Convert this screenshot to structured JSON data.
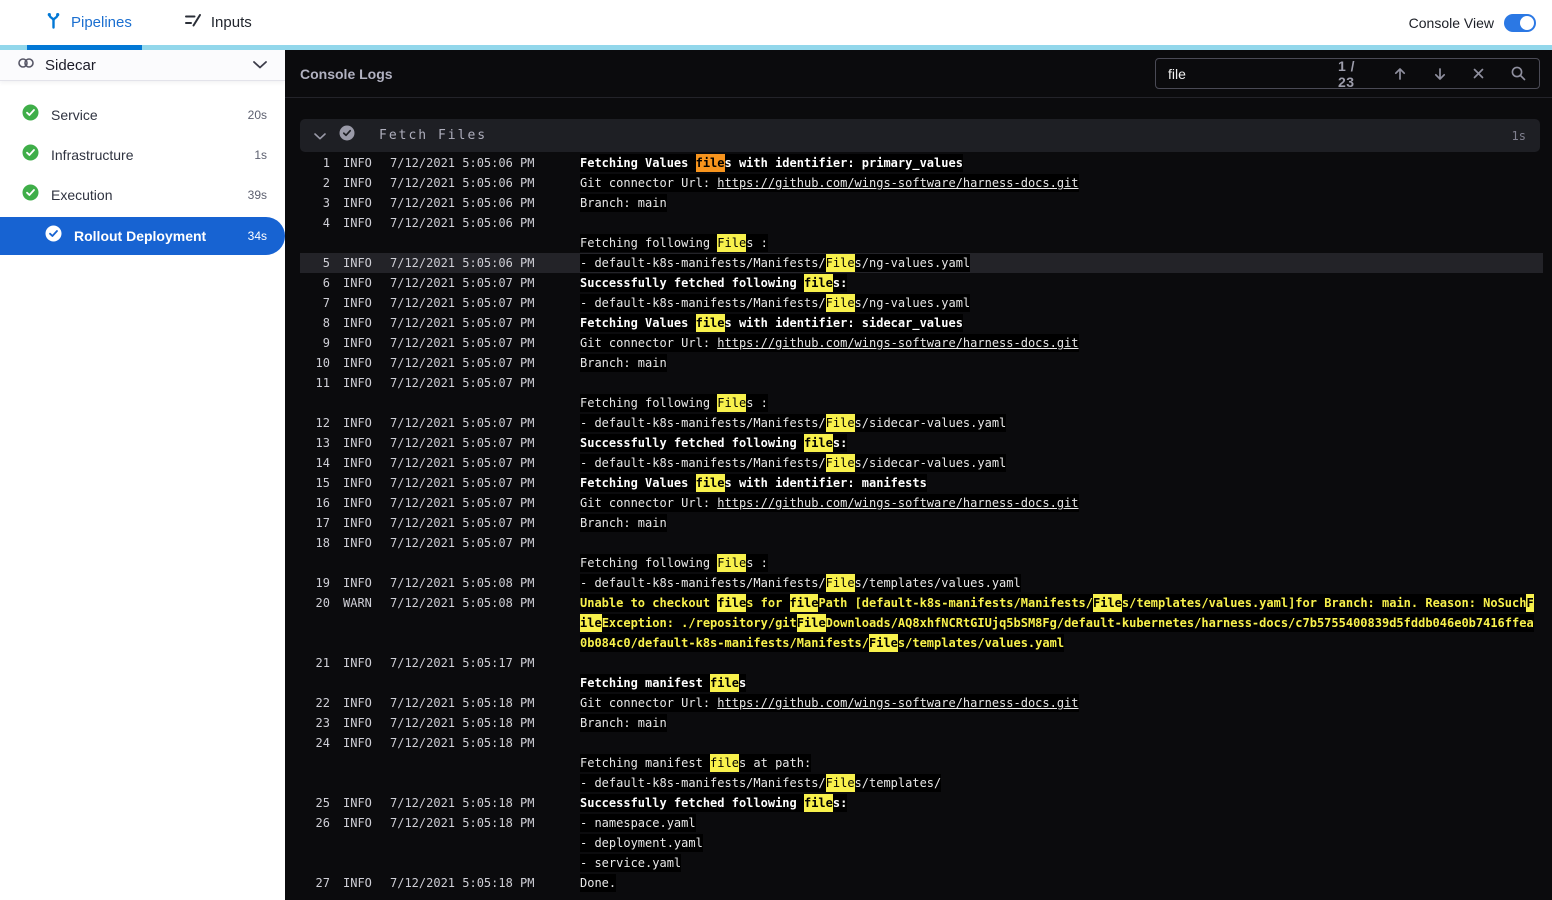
{
  "topbar": {
    "tabs": [
      {
        "label": "Pipelines"
      },
      {
        "label": "Inputs"
      }
    ],
    "console_view_label": "Console View",
    "console_view_on": true
  },
  "colors": {
    "primary_blue": "#0278d5",
    "selected_step_blue": "#1763d2",
    "divider_light_blue": "#92d7eb",
    "success_green": "#3fae49",
    "highlight_match": "#f8f14c",
    "highlight_current_match": "#f7941d",
    "warn_text": "#f8f14c"
  },
  "sidebar": {
    "stage": {
      "label": "Sidecar"
    },
    "items": [
      {
        "label": "Service",
        "duration": "20s",
        "status": "success"
      },
      {
        "label": "Infrastructure",
        "duration": "1s",
        "status": "success"
      },
      {
        "label": "Execution",
        "duration": "39s",
        "status": "success"
      }
    ],
    "selected_step": {
      "label": "Rollout Deployment",
      "duration": "34s",
      "status": "success"
    }
  },
  "console": {
    "title": "Console Logs",
    "search": {
      "value": "file",
      "counter": "1 / 23"
    },
    "section": {
      "title": "Fetch Files",
      "duration": "1s"
    },
    "rows": [
      {
        "n": "1",
        "lvl": "INFO",
        "t": "7/12/2021 5:05:06 PM",
        "seg": [
          {
            "t": "Fetching Values ",
            "b": 1
          },
          {
            "t": "file",
            "b": 1,
            "m": "c"
          },
          {
            "t": "s with identifier: primary_values",
            "b": 1
          }
        ]
      },
      {
        "n": "2",
        "lvl": "INFO",
        "t": "7/12/2021 5:05:06 PM",
        "seg": [
          {
            "t": "Git connector Url: "
          },
          {
            "t": "https://github.com/wings-software/harness-docs.git",
            "l": 1
          }
        ]
      },
      {
        "n": "3",
        "lvl": "INFO",
        "t": "7/12/2021 5:05:06 PM",
        "seg": [
          {
            "t": "Branch: main"
          }
        ]
      },
      {
        "n": "4",
        "lvl": "INFO",
        "t": "7/12/2021 5:05:06 PM",
        "seg": []
      },
      {
        "seg": [
          {
            "t": "Fetching following "
          },
          {
            "t": "File",
            "m": "y"
          },
          {
            "t": "s :"
          }
        ]
      },
      {
        "n": "5",
        "lvl": "INFO",
        "t": "7/12/2021 5:05:06 PM",
        "hl": 1,
        "seg": [
          {
            "t": "- default-k8s-manifests/Manifests/"
          },
          {
            "t": "File",
            "m": "y"
          },
          {
            "t": "s/ng-values.yaml"
          }
        ]
      },
      {
        "n": "6",
        "lvl": "INFO",
        "t": "7/12/2021 5:05:07 PM",
        "seg": [
          {
            "t": "Successfully fetched following ",
            "b": 1
          },
          {
            "t": "file",
            "b": 1,
            "m": "y"
          },
          {
            "t": "s:",
            "b": 1
          }
        ]
      },
      {
        "n": "7",
        "lvl": "INFO",
        "t": "7/12/2021 5:05:07 PM",
        "seg": [
          {
            "t": "- default-k8s-manifests/Manifests/"
          },
          {
            "t": "File",
            "m": "y"
          },
          {
            "t": "s/ng-values.yaml"
          }
        ]
      },
      {
        "n": "8",
        "lvl": "INFO",
        "t": "7/12/2021 5:05:07 PM",
        "seg": [
          {
            "t": "Fetching Values ",
            "b": 1
          },
          {
            "t": "file",
            "b": 1,
            "m": "y"
          },
          {
            "t": "s with identifier: sidecar_values",
            "b": 1
          }
        ]
      },
      {
        "n": "9",
        "lvl": "INFO",
        "t": "7/12/2021 5:05:07 PM",
        "seg": [
          {
            "t": "Git connector Url: "
          },
          {
            "t": "https://github.com/wings-software/harness-docs.git",
            "l": 1
          }
        ]
      },
      {
        "n": "10",
        "lvl": "INFO",
        "t": "7/12/2021 5:05:07 PM",
        "seg": [
          {
            "t": "Branch: main"
          }
        ]
      },
      {
        "n": "11",
        "lvl": "INFO",
        "t": "7/12/2021 5:05:07 PM",
        "seg": []
      },
      {
        "seg": [
          {
            "t": "Fetching following "
          },
          {
            "t": "File",
            "m": "y"
          },
          {
            "t": "s :"
          }
        ]
      },
      {
        "n": "12",
        "lvl": "INFO",
        "t": "7/12/2021 5:05:07 PM",
        "seg": [
          {
            "t": "- default-k8s-manifests/Manifests/"
          },
          {
            "t": "File",
            "m": "y"
          },
          {
            "t": "s/sidecar-values.yaml"
          }
        ]
      },
      {
        "n": "13",
        "lvl": "INFO",
        "t": "7/12/2021 5:05:07 PM",
        "seg": [
          {
            "t": "Successfully fetched following ",
            "b": 1
          },
          {
            "t": "file",
            "b": 1,
            "m": "y"
          },
          {
            "t": "s:",
            "b": 1
          }
        ]
      },
      {
        "n": "14",
        "lvl": "INFO",
        "t": "7/12/2021 5:05:07 PM",
        "seg": [
          {
            "t": "- default-k8s-manifests/Manifests/"
          },
          {
            "t": "File",
            "m": "y"
          },
          {
            "t": "s/sidecar-values.yaml"
          }
        ]
      },
      {
        "n": "15",
        "lvl": "INFO",
        "t": "7/12/2021 5:05:07 PM",
        "seg": [
          {
            "t": "Fetching Values ",
            "b": 1
          },
          {
            "t": "file",
            "b": 1,
            "m": "y"
          },
          {
            "t": "s with identifier: manifests",
            "b": 1
          }
        ]
      },
      {
        "n": "16",
        "lvl": "INFO",
        "t": "7/12/2021 5:05:07 PM",
        "seg": [
          {
            "t": "Git connector Url: "
          },
          {
            "t": "https://github.com/wings-software/harness-docs.git",
            "l": 1
          }
        ]
      },
      {
        "n": "17",
        "lvl": "INFO",
        "t": "7/12/2021 5:05:07 PM",
        "seg": [
          {
            "t": "Branch: main"
          }
        ]
      },
      {
        "n": "18",
        "lvl": "INFO",
        "t": "7/12/2021 5:05:07 PM",
        "seg": []
      },
      {
        "seg": [
          {
            "t": "Fetching following "
          },
          {
            "t": "File",
            "m": "y"
          },
          {
            "t": "s :"
          }
        ]
      },
      {
        "n": "19",
        "lvl": "INFO",
        "t": "7/12/2021 5:05:08 PM",
        "seg": [
          {
            "t": "- default-k8s-manifests/Manifests/"
          },
          {
            "t": "File",
            "m": "y"
          },
          {
            "t": "s/templates/values.yaml"
          }
        ]
      },
      {
        "n": "20",
        "lvl": "WARN",
        "t": "7/12/2021 5:05:08 PM",
        "seg": [
          {
            "t": "Unable to checkout ",
            "w": 1
          },
          {
            "t": "file",
            "w": 1,
            "m": "y"
          },
          {
            "t": "s for ",
            "w": 1
          },
          {
            "t": "file",
            "w": 1,
            "m": "y"
          },
          {
            "t": "Path [default-k8s-manifests/Manifests/",
            "w": 1
          },
          {
            "t": "File",
            "w": 1,
            "m": "y"
          },
          {
            "t": "s/templates/values.yaml]for Branch: main. Reason: NoSuch",
            "w": 1
          },
          {
            "t": "F",
            "w": 1,
            "m": "y"
          }
        ]
      },
      {
        "seg": [
          {
            "t": "ile",
            "w": 1,
            "m": "y"
          },
          {
            "t": "Exception: ./repository/git",
            "w": 1
          },
          {
            "t": "File",
            "w": 1,
            "m": "y"
          },
          {
            "t": "Downloads/AQ8xhfNCRtGIUjq5bSM8Fg/default-kubernetes/harness-docs/c7b5755400839d5fddb046e0b7416ffea",
            "w": 1
          }
        ]
      },
      {
        "seg": [
          {
            "t": "0b084c0/default-k8s-manifests/Manifests/",
            "w": 1
          },
          {
            "t": "File",
            "w": 1,
            "m": "y"
          },
          {
            "t": "s/templates/values.yaml",
            "w": 1
          }
        ]
      },
      {
        "n": "21",
        "lvl": "INFO",
        "t": "7/12/2021 5:05:17 PM",
        "seg": []
      },
      {
        "seg": [
          {
            "t": "Fetching manifest ",
            "b": 1
          },
          {
            "t": "file",
            "b": 1,
            "m": "y"
          },
          {
            "t": "s",
            "b": 1
          }
        ]
      },
      {
        "n": "22",
        "lvl": "INFO",
        "t": "7/12/2021 5:05:18 PM",
        "seg": [
          {
            "t": "Git connector Url: "
          },
          {
            "t": "https://github.com/wings-software/harness-docs.git",
            "l": 1
          }
        ]
      },
      {
        "n": "23",
        "lvl": "INFO",
        "t": "7/12/2021 5:05:18 PM",
        "seg": [
          {
            "t": "Branch: main"
          }
        ]
      },
      {
        "n": "24",
        "lvl": "INFO",
        "t": "7/12/2021 5:05:18 PM",
        "seg": []
      },
      {
        "seg": [
          {
            "t": "Fetching manifest "
          },
          {
            "t": "file",
            "m": "y"
          },
          {
            "t": "s at path:"
          }
        ]
      },
      {
        "seg": [
          {
            "t": "- default-k8s-manifests/Manifests/"
          },
          {
            "t": "File",
            "m": "y"
          },
          {
            "t": "s/templates/"
          }
        ]
      },
      {
        "n": "25",
        "lvl": "INFO",
        "t": "7/12/2021 5:05:18 PM",
        "seg": [
          {
            "t": "Successfully fetched following ",
            "b": 1
          },
          {
            "t": "file",
            "b": 1,
            "m": "y"
          },
          {
            "t": "s:",
            "b": 1
          }
        ]
      },
      {
        "n": "26",
        "lvl": "INFO",
        "t": "7/12/2021 5:05:18 PM",
        "seg": [
          {
            "t": "- namespace.yaml"
          }
        ]
      },
      {
        "seg": [
          {
            "t": "- deployment.yaml"
          }
        ]
      },
      {
        "seg": [
          {
            "t": "- service.yaml"
          }
        ]
      },
      {
        "n": "27",
        "lvl": "INFO",
        "t": "7/12/2021 5:05:18 PM",
        "seg": [
          {
            "t": "Done."
          }
        ]
      }
    ]
  }
}
